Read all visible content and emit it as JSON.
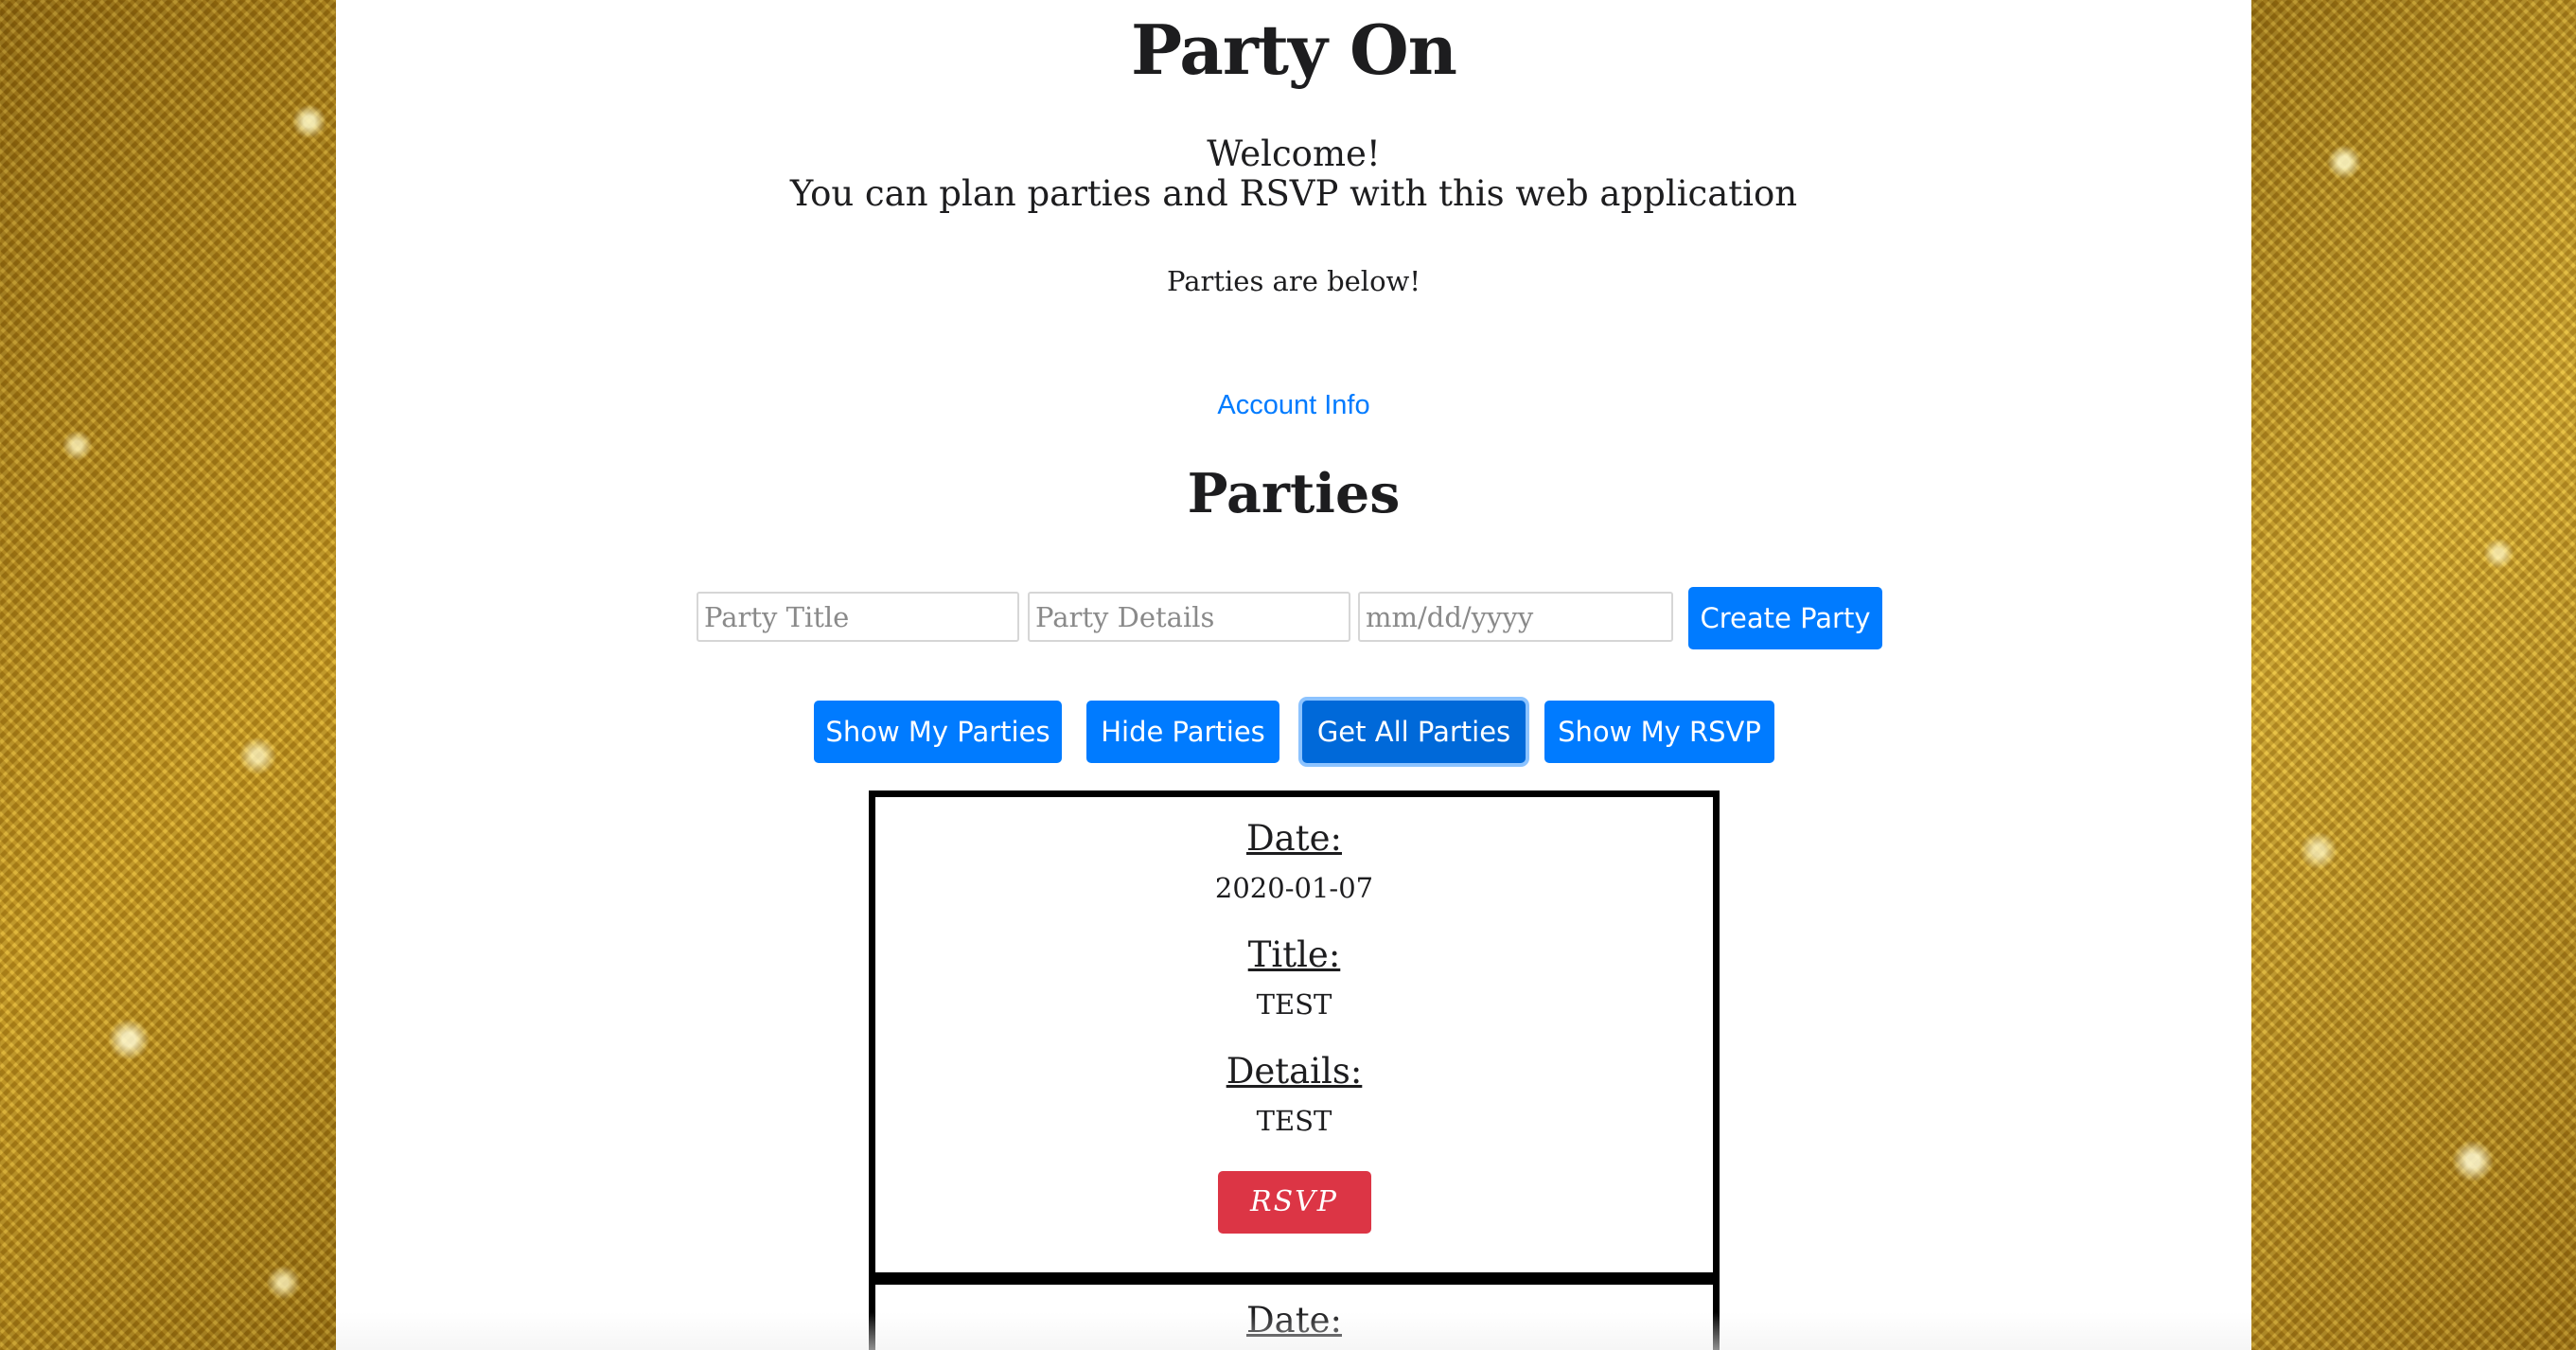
{
  "site": {
    "title": "Party On",
    "welcome_line1": "Welcome!",
    "welcome_line2": "You can plan parties and RSVP with this web application",
    "parties_below": "Parties are below!",
    "account_link": "Account Info",
    "section_title": "Parties"
  },
  "create_form": {
    "title_placeholder": "Party Title",
    "details_placeholder": "Party Details",
    "date_placeholder": "mm/dd/yyyy",
    "create_button": "Create Party"
  },
  "actions": {
    "show_my_parties": "Show My Parties",
    "hide_parties": "Hide Parties",
    "get_all_parties": "Get All Parties",
    "show_my_rsvp": "Show My RSVP"
  },
  "labels": {
    "date": "Date:",
    "title": "Title:",
    "details": "Details:",
    "rsvp": "RSVP"
  },
  "parties": [
    {
      "date": "2020-01-07",
      "title": "TEST",
      "details": "TEST"
    }
  ],
  "colors": {
    "primary": "#007bff",
    "primary_active": "#0069d9",
    "danger": "#dc3545",
    "card_border": "#000000",
    "background_theme": "gold glitter"
  }
}
